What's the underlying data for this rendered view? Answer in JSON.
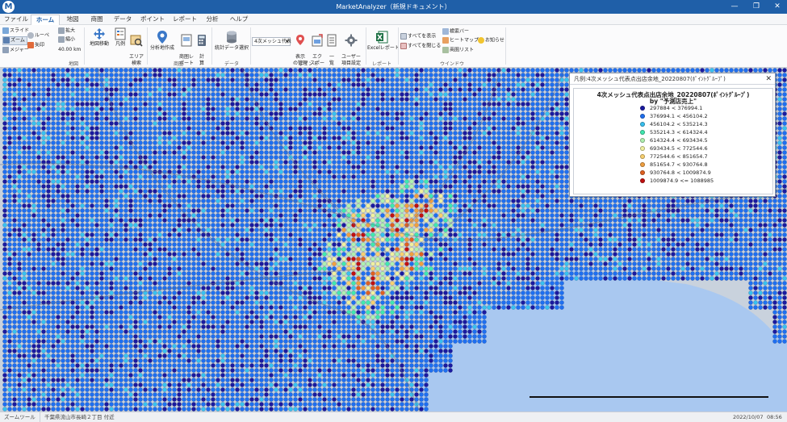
{
  "window": {
    "title": "MarketAnalyzer（新規ドキュメント）",
    "icon": "app-logo-icon"
  },
  "menu": {
    "tabs": [
      {
        "label": "ファイル",
        "active": false
      },
      {
        "label": "ホーム",
        "active": true
      },
      {
        "label": "地図",
        "active": false
      },
      {
        "label": "商圏",
        "active": false
      },
      {
        "label": "データ",
        "active": false
      },
      {
        "label": "ポイント",
        "active": false
      },
      {
        "label": "レポート",
        "active": false
      },
      {
        "label": "分析",
        "active": false
      },
      {
        "label": "ヘルプ",
        "active": false
      }
    ]
  },
  "ribbon": {
    "mode": {
      "slide": "スライド",
      "zoom": "ズーム",
      "measure": "メジャー"
    },
    "tools": {
      "loupe": "ルーペ",
      "arrow": "矢印"
    },
    "zoom": {
      "in": "拡大",
      "out": "縮小",
      "scale": "40.00 km"
    },
    "map_group": {
      "move": "地図移動",
      "legend": "凡例",
      "label": "地図"
    },
    "area": {
      "search": "エリア\n検索"
    },
    "trade_area": {
      "create": "分析地作成",
      "report": "商圏レ\nポート",
      "calc": "計\n算",
      "label": "商圏"
    },
    "data_group": {
      "select": "統計データ選択",
      "label": "データ"
    },
    "point_group": {
      "layer_dropdown": "4次メッシュ代表",
      "manage": "表示\nの管理",
      "export": "エク\nスポート",
      "list": "一\n覧",
      "user_settings": "ユーザー\n項目設定",
      "label": "ポイント"
    },
    "report_group": {
      "excel": "Excelレポート",
      "label": "レポート"
    },
    "window_group": {
      "show_all": "すべてを表示",
      "close_all": "すべてを閉じる",
      "search_bar": "検索バー",
      "heatmap": "ヒートマップ",
      "trade_list": "商圏リスト",
      "notice": "お知らせ",
      "label": "ウインドウ"
    }
  },
  "legend": {
    "window_title": "凡例:4次メッシュ代表点出店余地_20220807(ﾎﾟｲﾝﾄｸﾞﾙｰﾌﾟ)",
    "title": "4次メッシュ代表点出店余地_20220807(ﾎﾟｲﾝﾄｸﾞﾙｰﾌﾟ)",
    "subtitle": "by \"予測店売上\"",
    "classes": [
      {
        "range": "297884 < 376994.1",
        "color": "#1a1aa0"
      },
      {
        "range": "376994.1 < 456104.2",
        "color": "#1e6ff0"
      },
      {
        "range": "456104.2 < 535214.3",
        "color": "#38c0f0"
      },
      {
        "range": "535214.3 < 614324.4",
        "color": "#40e8b0"
      },
      {
        "range": "614324.4 < 693434.5",
        "color": "#b0f0b0"
      },
      {
        "range": "693434.5 < 772544.6",
        "color": "#f0f0a0"
      },
      {
        "range": "772544.6 < 851654.7",
        "color": "#f8d070"
      },
      {
        "range": "851654.7 < 930764.8",
        "color": "#f0a040"
      },
      {
        "range": "930764.8 < 1009874.9",
        "color": "#e06020"
      },
      {
        "range": "1009874.9 <= 1088985",
        "color": "#c01010"
      }
    ]
  },
  "statusbar": {
    "tool": "ズームツール",
    "location": "千葉県流山市長崎２丁目 付近",
    "date": "2022/10/07",
    "time": "08:56"
  },
  "colors": {
    "titlebar": "#1f5fa8",
    "sea": "#a9c8f0",
    "map_bg": "#c9d2dd"
  }
}
